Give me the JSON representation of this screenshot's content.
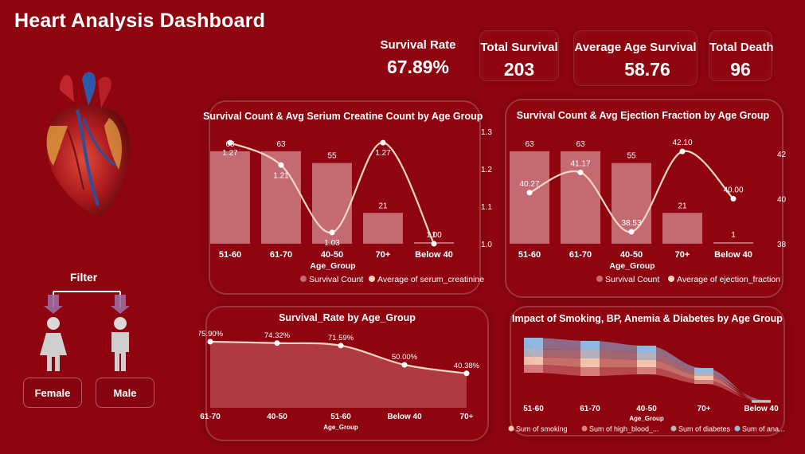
{
  "header": {
    "title": "Heart Analysis Dashboard"
  },
  "kpis": [
    {
      "label": "Survival Rate",
      "value": "67.89%"
    },
    {
      "label": "Total Survival",
      "value": "203"
    },
    {
      "label": "Average Age Survival",
      "value": "58.76"
    },
    {
      "label": "Total Death",
      "value": "96"
    }
  ],
  "filter": {
    "title": "Filter",
    "female_label": "Female",
    "male_label": "Male"
  },
  "colors": {
    "background": "#8e0510",
    "bar": "#c46a73",
    "line": "#f7d6c4",
    "area": "#b44048"
  },
  "chart_creatinine": {
    "title": "Survival Count & Avg Serium Creatine Count by Age Group",
    "xlabel": "Age_Group",
    "legend": [
      "Survival Count",
      "Average of serum_creatinine"
    ],
    "categories": [
      "51-60",
      "61-70",
      "40-50",
      "70+",
      "Below 40"
    ],
    "bars": [
      63,
      63,
      55,
      21,
      1
    ],
    "bar_labels": [
      "63",
      "63",
      "55",
      "21",
      "1"
    ],
    "line": [
      1.27,
      1.21,
      1.03,
      1.27,
      1.0
    ],
    "line_labels": [
      "1.27",
      "1.21",
      "1.03",
      "1.27",
      "1.00"
    ],
    "y2_ticks": [
      "1.3",
      "1.2",
      "1.1",
      "1.0"
    ]
  },
  "chart_ejection": {
    "title": "Survival Count & Avg Ejection Fraction by Age Group",
    "xlabel": "Age_Group",
    "legend": [
      "Survival Count",
      "Average of ejection_fraction"
    ],
    "categories": [
      "51-60",
      "61-70",
      "40-50",
      "70+",
      "Below 40"
    ],
    "bars": [
      63,
      63,
      55,
      21,
      1
    ],
    "bar_labels": [
      "63",
      "63",
      "55",
      "21",
      "1"
    ],
    "line": [
      40.27,
      41.17,
      38.53,
      42.1,
      40.0
    ],
    "line_labels": [
      "40.27",
      "41.17",
      "38.53",
      "42.10",
      "40.00"
    ],
    "y2_ticks": [
      "42",
      "40",
      "38"
    ]
  },
  "chart_survival_rate": {
    "title": "Survival_Rate by Age_Group",
    "xlabel": "Age_Group",
    "categories": [
      "61-70",
      "40-50",
      "51-60",
      "Below 40",
      "70+"
    ],
    "values": [
      75.9,
      74.32,
      71.59,
      50.0,
      40.38
    ],
    "value_labels": [
      "75.90%",
      "74.32%",
      "71.59%",
      "50.00%",
      "40.38%"
    ]
  },
  "chart_impact": {
    "title": "Impact of Smoking, BP, Anemia & Diabetes by Age Group",
    "xlabel": "Age_Group",
    "categories": [
      "51-60",
      "61-70",
      "40-50",
      "70+",
      "Below 40"
    ],
    "legend": [
      "Sum of smoking",
      "Sum of high_blood_...",
      "Sum of diabetes",
      "Sum of ana..."
    ]
  },
  "chart_data": [
    {
      "type": "bar",
      "title": "Survival Count & Avg Serium Creatine Count by Age Group",
      "xlabel": "Age_Group",
      "categories": [
        "51-60",
        "61-70",
        "40-50",
        "70+",
        "Below 40"
      ],
      "series": [
        {
          "name": "Survival Count",
          "values": [
            63,
            63,
            55,
            21,
            1
          ]
        },
        {
          "name": "Average of serum_creatinine",
          "values": [
            1.27,
            1.21,
            1.03,
            1.27,
            1.0
          ]
        }
      ],
      "y2lim": [
        1.0,
        1.3
      ]
    },
    {
      "type": "bar",
      "title": "Survival Count & Avg Ejection Fraction by Age Group",
      "xlabel": "Age_Group",
      "categories": [
        "51-60",
        "61-70",
        "40-50",
        "70+",
        "Below 40"
      ],
      "series": [
        {
          "name": "Survival Count",
          "values": [
            63,
            63,
            55,
            21,
            1
          ]
        },
        {
          "name": "Average of ejection_fraction",
          "values": [
            40.27,
            41.17,
            38.53,
            42.1,
            40.0
          ]
        }
      ],
      "y2lim": [
        38,
        42
      ]
    },
    {
      "type": "area",
      "title": "Survival_Rate by Age_Group",
      "xlabel": "Age_Group",
      "categories": [
        "61-70",
        "40-50",
        "51-60",
        "Below 40",
        "70+"
      ],
      "values": [
        75.9,
        74.32,
        71.59,
        50.0,
        40.38
      ]
    }
  ]
}
